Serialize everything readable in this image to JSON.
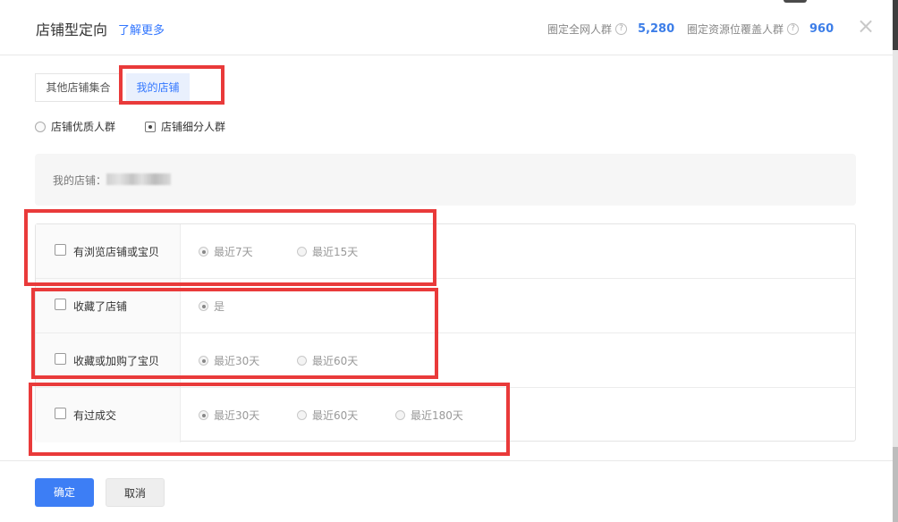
{
  "header": {
    "title": "店铺型定向",
    "learn_more": "了解更多",
    "stat1_label": "圈定全网人群",
    "stat1_value": "5,280",
    "stat2_label": "圈定资源位覆盖人群",
    "stat2_value": "960",
    "help_glyph": "?",
    "close_glyph": "×"
  },
  "tabs": [
    {
      "label": "其他店铺集合"
    },
    {
      "label": "我的店铺"
    }
  ],
  "radios": [
    {
      "label": "店铺优质人群"
    },
    {
      "label": "店铺细分人群"
    }
  ],
  "store": {
    "label": "我的店铺："
  },
  "rows": [
    {
      "label": "有浏览店铺或宝贝",
      "options": [
        "最近7天",
        "最近15天"
      ]
    },
    {
      "label": "收藏了店铺",
      "options": [
        "是"
      ]
    },
    {
      "label": "收藏或加购了宝贝",
      "options": [
        "最近30天",
        "最近60天"
      ]
    },
    {
      "label": "有过成交",
      "options": [
        "最近30天",
        "最近60天",
        "最近180天"
      ]
    }
  ],
  "footer": {
    "ok": "确定",
    "cancel": "取消"
  },
  "colors": {
    "accent": "#3d7ef5",
    "annotation_red": "#e93a3a"
  }
}
